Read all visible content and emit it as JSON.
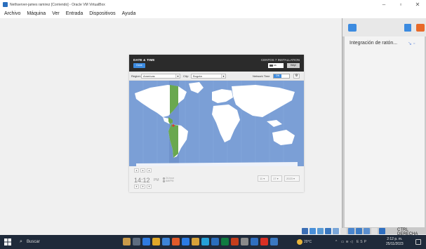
{
  "window": {
    "title": "Nethserver-james ramirez [Corriendo] - Oracle VM VirtualBox",
    "minimize": "–",
    "maximize": "▫",
    "close": "✕"
  },
  "menubar": {
    "items": [
      "Archivo",
      "Máquina",
      "Ver",
      "Entrada",
      "Dispositivos",
      "Ayuda"
    ]
  },
  "installer": {
    "section_title": "DATE & TIME",
    "done_label": "Done",
    "product": "CENTOS 7 INSTALLATION",
    "keyboard": "us",
    "help_label": "Help!",
    "region_label": "Region:",
    "region_value": "Americas",
    "city_label": "City:",
    "city_value": "Bogota",
    "network_time_label": "Network Time",
    "network_time_state": "ON",
    "time_hours": "14",
    "time_minutes": "12",
    "time_separator": ":",
    "ampm": "PM",
    "format_24": "24-hour",
    "format_ampm": "AM/PM",
    "month": "11",
    "day": "17",
    "year": "2023"
  },
  "right_panel": {
    "item_label": "Integración de ratón..."
  },
  "status_bar": {
    "host_key": "CTRL DERECHA"
  },
  "taskbar": {
    "search_placeholder": "Buscar",
    "weather": "20°C",
    "language": "ESP",
    "time": "2:12 p. m.",
    "date": "25/11/2023"
  },
  "colors": {
    "accent": "#3c8be0",
    "header_bg": "#2b2b2b",
    "map_ocean": "#7b9fd6",
    "timezone_band": "#5a8e3c",
    "taskbar_bg": "#1f2a3a"
  }
}
